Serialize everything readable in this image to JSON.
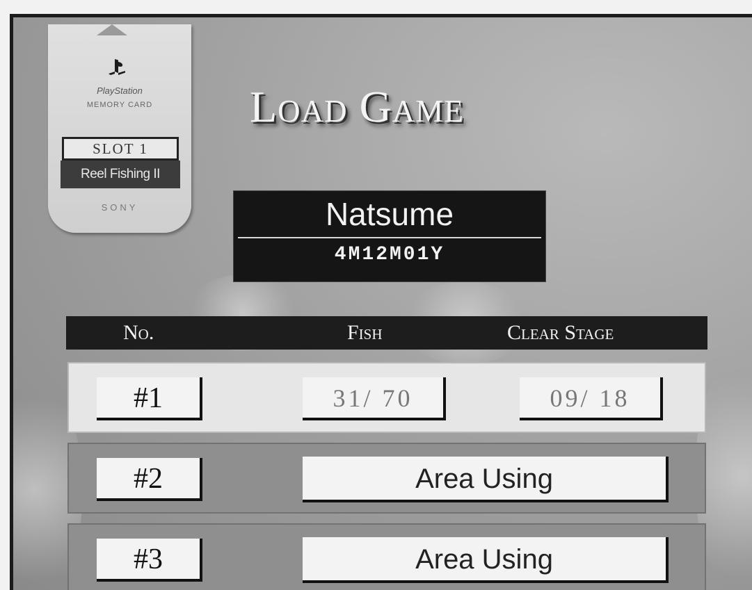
{
  "memory_card": {
    "brand": "PlayStation",
    "model": "MEMORY CARD",
    "slot": "SLOT 1",
    "game": "Reel Fishing II",
    "maker": "SONY"
  },
  "title": "Load Game",
  "profile": {
    "name": "Natsume",
    "time": "4M12M01Y"
  },
  "table": {
    "headers": {
      "no": "No.",
      "fish": "Fish",
      "clear_stage": "Clear Stage"
    },
    "rows": [
      {
        "no": "#1",
        "fish": "31/ 70",
        "clear_stage": "09/ 18"
      },
      {
        "no": "#2",
        "status": "Area Using"
      },
      {
        "no": "#3",
        "status": "Area Using"
      }
    ]
  }
}
